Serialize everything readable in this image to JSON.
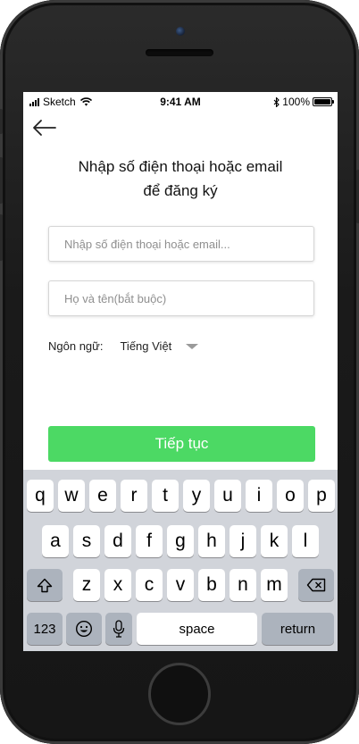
{
  "status_bar": {
    "carrier": "Sketch",
    "time": "9:41 AM",
    "battery": "100%"
  },
  "header": {
    "back_icon": "arrow-left-icon"
  },
  "form": {
    "title_line1": "Nhập số điện thoại hoặc email",
    "title_line2": "để đăng ký",
    "phone_email_placeholder": "Nhập số điện thoại hoặc email...",
    "phone_email_value": "",
    "name_placeholder": "Họ và tên(bắt buộc)",
    "name_value": "",
    "language_label": "Ngôn ngữ:",
    "language_value": "Tiếng Việt",
    "continue_label": "Tiếp tục"
  },
  "keyboard": {
    "row1": [
      "q",
      "w",
      "e",
      "r",
      "t",
      "y",
      "u",
      "i",
      "o",
      "p"
    ],
    "row2": [
      "a",
      "s",
      "d",
      "f",
      "g",
      "h",
      "j",
      "k",
      "l"
    ],
    "row3": [
      "z",
      "x",
      "c",
      "v",
      "b",
      "n",
      "m"
    ],
    "numbers_label": "123",
    "space_label": "space",
    "return_label": "return"
  },
  "colors": {
    "accent": "#4cd964",
    "keyboard_bg": "#d1d4da",
    "function_key": "#acb3bd"
  }
}
